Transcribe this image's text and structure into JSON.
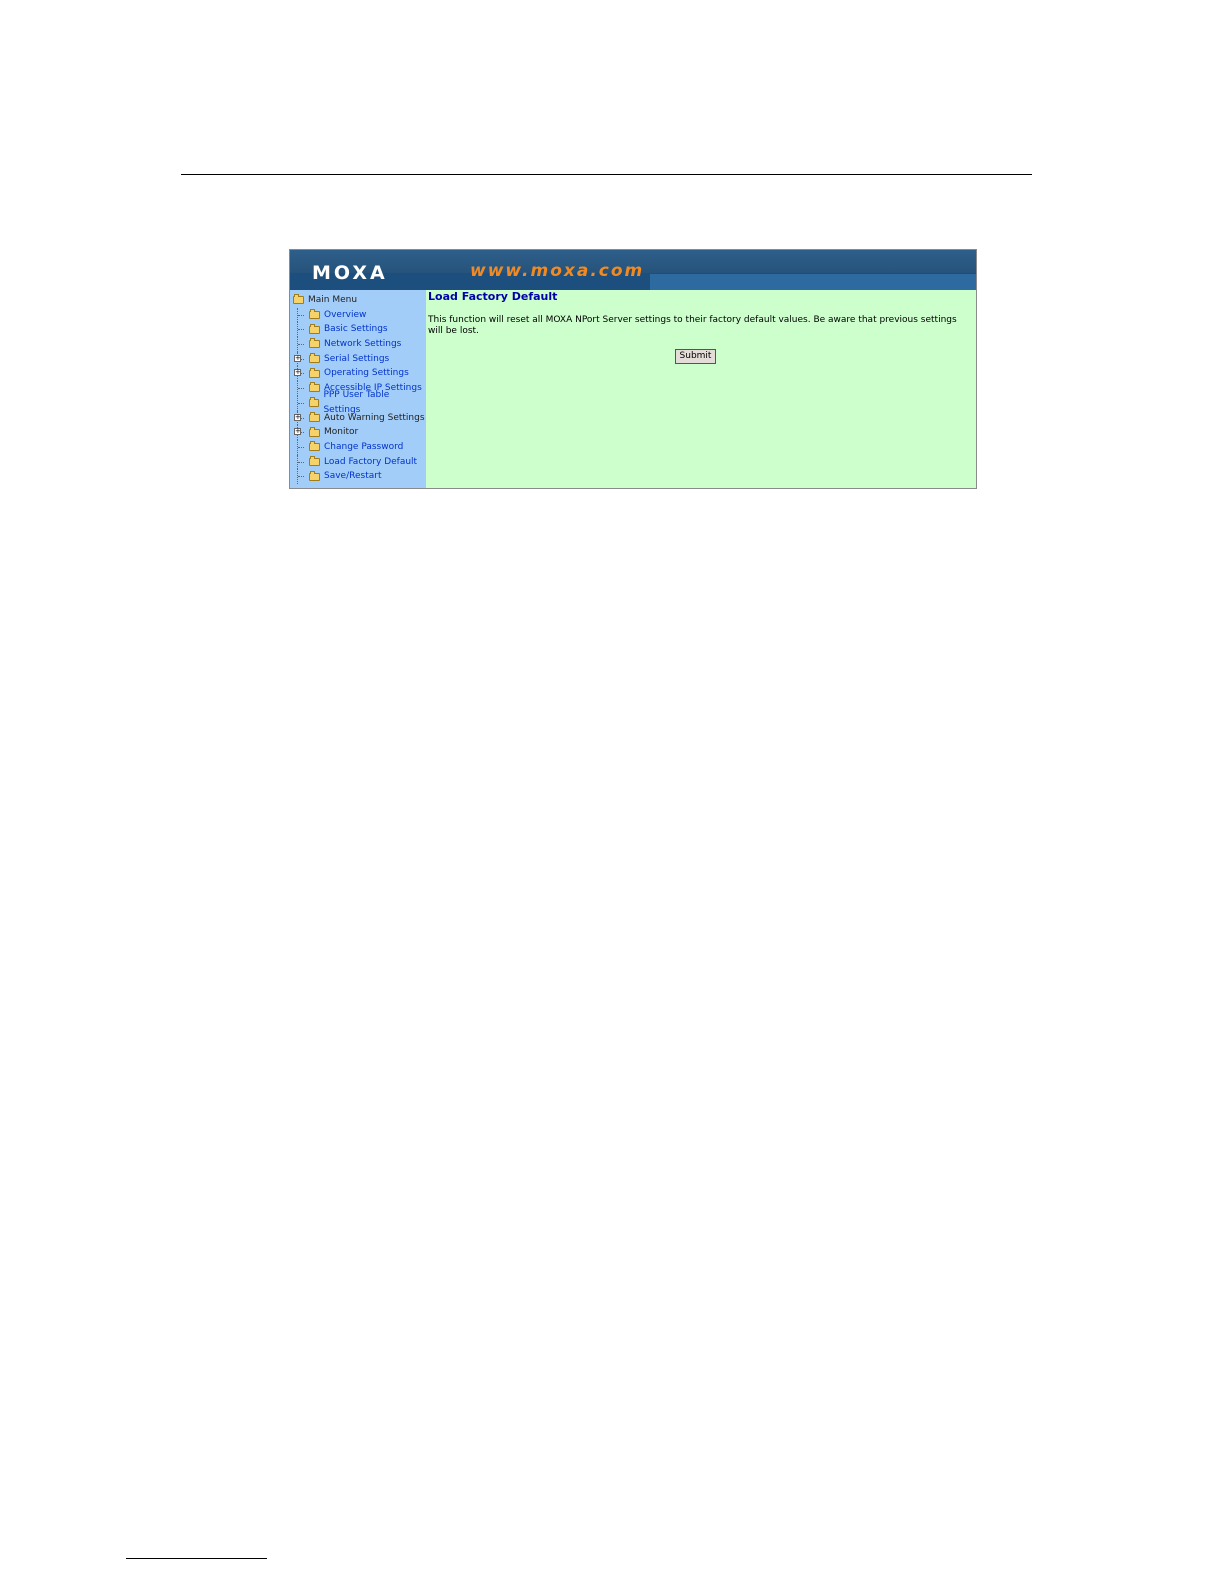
{
  "banner": {
    "logo": "MOXA",
    "url": "www.moxa.com"
  },
  "sidebar": {
    "root": "Main Menu",
    "items": [
      {
        "label": "Overview",
        "expandable": false,
        "link": true
      },
      {
        "label": "Basic Settings",
        "expandable": false,
        "link": true
      },
      {
        "label": "Network Settings",
        "expandable": false,
        "link": true
      },
      {
        "label": "Serial Settings",
        "expandable": true,
        "link": true
      },
      {
        "label": "Operating Settings",
        "expandable": true,
        "link": true
      },
      {
        "label": "Accessible IP Settings",
        "expandable": false,
        "link": true
      },
      {
        "label": "PPP User Table Settings",
        "expandable": false,
        "link": true
      },
      {
        "label": "Auto Warning Settings",
        "expandable": true,
        "link": false
      },
      {
        "label": "Monitor",
        "expandable": true,
        "link": false
      },
      {
        "label": "Change Password",
        "expandable": false,
        "link": true
      },
      {
        "label": "Load Factory Default",
        "expandable": false,
        "link": true
      },
      {
        "label": "Save/Restart",
        "expandable": false,
        "link": true
      }
    ]
  },
  "main": {
    "title": "Load Factory Default",
    "description": "This function will reset all MOXA NPort Server settings to their factory default values. Be aware that previous settings will be lost.",
    "submit_label": "Submit"
  },
  "colors": {
    "banner": "#1f4a70",
    "url": "#f08a24",
    "sidebar": "#a3cdf9",
    "content": "#ccffcc",
    "title": "#0000aa"
  }
}
